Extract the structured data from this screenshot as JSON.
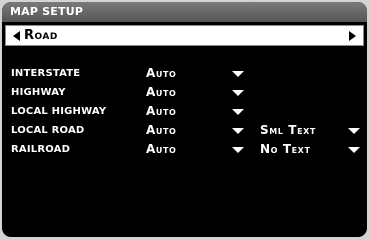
{
  "window": {
    "title": "MAP SETUP"
  },
  "selector": {
    "value": "Road",
    "left_icon": "triangle-left-icon",
    "right_icon": "triangle-right-icon"
  },
  "rows": [
    {
      "label": "INTERSTATE",
      "value": "Auto",
      "text_value": ""
    },
    {
      "label": "HIGHWAY",
      "value": "Auto",
      "text_value": ""
    },
    {
      "label": "LOCAL HIGHWAY",
      "value": "Auto",
      "text_value": ""
    },
    {
      "label": "LOCAL ROAD",
      "value": "Auto",
      "text_value": "Sml Text"
    },
    {
      "label": "RAILROAD",
      "value": "Auto",
      "text_value": "No Text"
    }
  ],
  "colors": {
    "background": "#000000",
    "title_bar": "#6a6a6a",
    "selector_bg": "#ffffff",
    "text": "#ffffff"
  }
}
